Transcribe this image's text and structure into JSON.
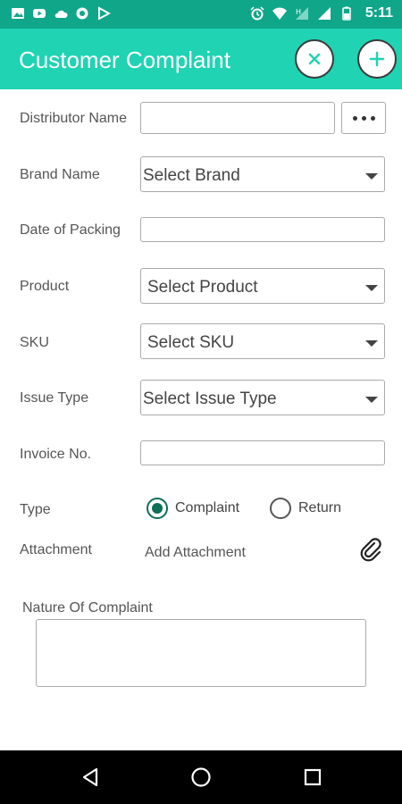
{
  "status_bar": {
    "time": "5:11",
    "left_icons": [
      "image-icon",
      "youtube-icon",
      "cloud-icon",
      "app-icon",
      "play-icon"
    ],
    "right_icons": [
      "alarm-icon",
      "wifi-icon",
      "signal-h-icon",
      "signal-icon",
      "battery-icon"
    ]
  },
  "app_bar": {
    "title": "Customer Complaint",
    "close_icon": "close-icon",
    "add_icon": "plus-icon"
  },
  "form": {
    "distributor_name": {
      "label": "Distributor Name",
      "value": "",
      "more_icon": "more-horizontal-icon"
    },
    "brand_name": {
      "label": "Brand Name",
      "selected": "Select Brand"
    },
    "date_of_packing": {
      "label": "Date of Packing",
      "value": ""
    },
    "product": {
      "label": "Product",
      "selected": "Select Product"
    },
    "sku": {
      "label": "SKU",
      "selected": "Select SKU"
    },
    "issue_type": {
      "label": "Issue Type",
      "selected": "Select Issue Type"
    },
    "invoice_no": {
      "label": "Invoice No.",
      "value": ""
    },
    "type": {
      "label": "Type",
      "options": [
        {
          "label": "Complaint",
          "checked": true
        },
        {
          "label": "Return",
          "checked": false
        }
      ]
    },
    "attachment": {
      "label": "Attachment",
      "action": "Add Attachment",
      "icon": "paperclip-icon"
    },
    "nature_of_complaint": {
      "label": "Nature Of Complaint",
      "value": ""
    }
  },
  "colors": {
    "status_bar": "#10a68a",
    "app_bar": "#1fd3b3",
    "radio_checked": "#0f6e58",
    "nav_bar": "#000000"
  },
  "nav_bar": {
    "buttons": [
      "back-icon",
      "home-icon",
      "recents-icon"
    ]
  }
}
